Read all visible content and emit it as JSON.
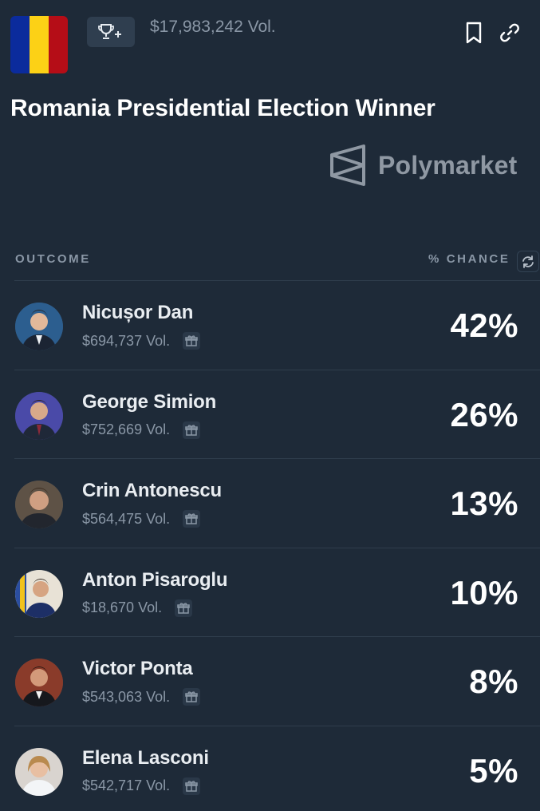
{
  "header": {
    "flag_colors": [
      "#0b2b9c",
      "#fcd116",
      "#ce1126"
    ],
    "trophy_icon": "trophy-plus-icon",
    "volume": "$17,983,242 Vol.",
    "bookmark_icon": "bookmark-icon",
    "link_icon": "link-icon"
  },
  "title": "Romania Presidential Election Winner",
  "brand": {
    "name": "Polymarket",
    "logo_icon": "polymarket-logo-icon"
  },
  "table": {
    "outcome_header": "OUTCOME",
    "chance_header": "% CHANCE",
    "refresh_icon": "refresh-icon",
    "rows": [
      {
        "name": "Nicușor Dan",
        "volume": "$694,737 Vol.",
        "chance": "42%",
        "avatar_color": "#2c5e8f",
        "gift_icon": "gift-icon"
      },
      {
        "name": "George Simion",
        "volume": "$752,669 Vol.",
        "chance": "26%",
        "avatar_color": "#3b3a8c",
        "gift_icon": "gift-icon"
      },
      {
        "name": "Crin Antonescu",
        "volume": "$564,475 Vol.",
        "chance": "13%",
        "avatar_color": "#6b5a4a",
        "gift_icon": "gift-icon"
      },
      {
        "name": "Anton Pisaroglu",
        "volume": "$18,670 Vol.",
        "chance": "10%",
        "avatar_color": "#2b3f7a",
        "gift_icon": "gift-icon"
      },
      {
        "name": "Victor Ponta",
        "volume": "$543,063 Vol.",
        "chance": "8%",
        "avatar_color": "#7a3a2a",
        "gift_icon": "gift-icon"
      },
      {
        "name": "Elena Lasconi",
        "volume": "$542,717 Vol.",
        "chance": "5%",
        "avatar_color": "#c9c4bf",
        "gift_icon": "gift-icon"
      }
    ]
  }
}
